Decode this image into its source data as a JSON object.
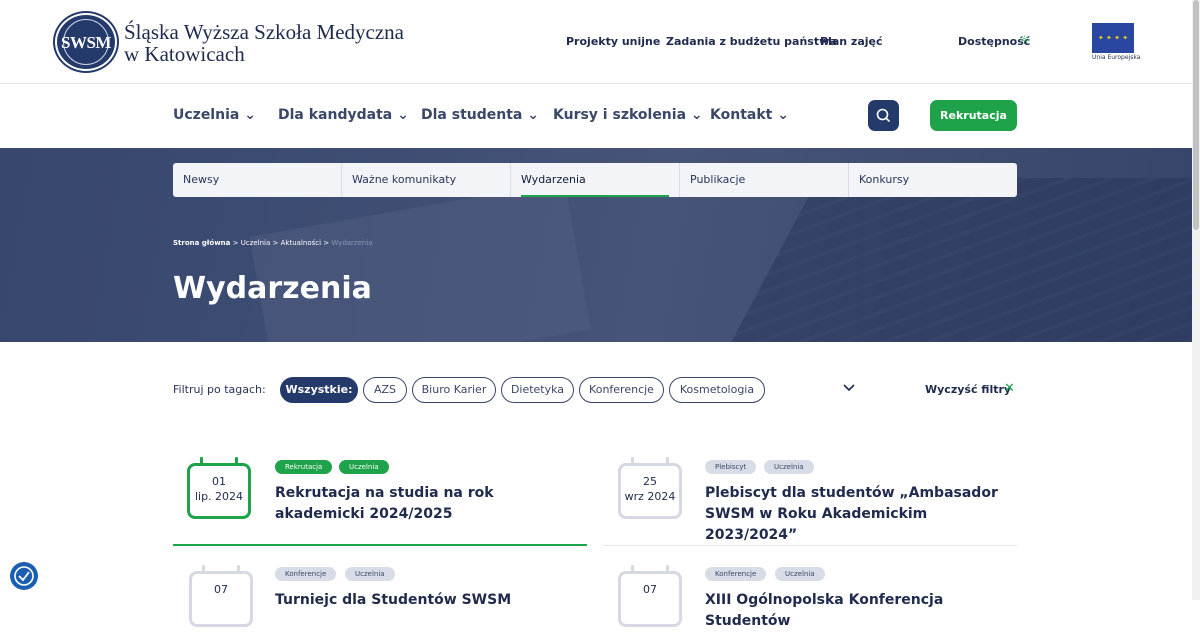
{
  "header": {
    "logo_abbr": "SWSM",
    "logo_line1": "Śląska Wyższa Szkoła Medyczna",
    "logo_line2": "w Katowicach",
    "links": [
      "Projekty unijne",
      "Zadania z budżetu państwa",
      "Plan zajęć",
      "Dostępność"
    ],
    "eu_label": "Unia Europejska"
  },
  "nav": {
    "items": [
      "Uczelnia",
      "Dla kandydata",
      "Dla studenta",
      "Kursy i szkolenia",
      "Kontakt"
    ],
    "cta": "Rekrutacja"
  },
  "tabs": [
    "Newsy",
    "Ważne komunikaty",
    "Wydarzenia",
    "Publikacje",
    "Konkursy"
  ],
  "breadcrumb": [
    "Strona główna",
    "Uczelnia",
    "Aktualności",
    "Wydarzenia"
  ],
  "page_title": "Wydarzenia",
  "filters": {
    "label": "Filtruj po tagach:",
    "chips": [
      "Wszystkie:",
      "AZS",
      "Biuro Karier",
      "Dietetyka",
      "Konferencje",
      "Kosmetologia"
    ],
    "clear": "Wyczyść filtry"
  },
  "events": [
    {
      "day": "01",
      "month": "lip. 2024",
      "tags": [
        "Rekrutacja",
        "Uczelnia"
      ],
      "title": "Rekrutacja na studia na rok akademicki 2024/2025"
    },
    {
      "day": "25",
      "month": "wrz 2024",
      "tags": [
        "Plebiscyt",
        "Uczelnia"
      ],
      "title": "Plebiscyt dla studentów „Ambasador SWSM w Roku Akademickim 2023/2024”"
    },
    {
      "day": "07",
      "month": "",
      "tags": [
        "Konferencje",
        "Uczelnia"
      ],
      "title": "Turniejc dla Studentów SWSM"
    },
    {
      "day": "07",
      "month": "",
      "tags": [
        "Konferencje",
        "Uczelnia"
      ],
      "title": "XIII Ogólnopolska Konferencja Studentów"
    }
  ],
  "colors": {
    "primary": "#243a6b",
    "accent": "#1ea34a"
  }
}
